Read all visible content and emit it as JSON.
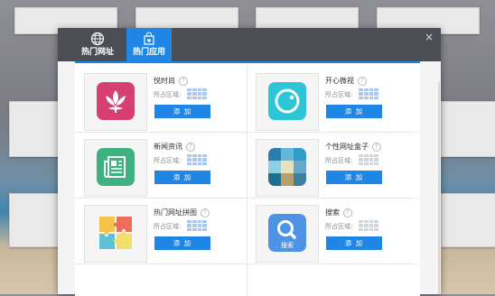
{
  "tabs": [
    {
      "label": "热门网址",
      "icon": "globe-icon",
      "active": false
    },
    {
      "label": "热门应用",
      "icon": "shopping-bag-icon",
      "active": true
    }
  ],
  "close_label": "×",
  "region_label": "所占区域:",
  "add_label": "添 加",
  "help_glyph": "?",
  "apps": [
    {
      "name": "悦时尚",
      "icon": "lotus-icon",
      "color": "#d63f73"
    },
    {
      "name": "开心微视",
      "icon": "camera-lens-icon",
      "color": "#2cc6d6"
    },
    {
      "name": "新闻资讯",
      "icon": "newspaper-icon",
      "color": "#3fb07f"
    },
    {
      "name": "个性网址盒子",
      "icon": "color-grid-icon",
      "color": "#2f8fb6"
    },
    {
      "name": "热门网址拼图",
      "icon": "puzzle-icon",
      "color": "#f0b94a"
    },
    {
      "name": "搜索",
      "icon": "search-icon",
      "color": "#4f93e6",
      "icon_text": "搜索"
    }
  ]
}
